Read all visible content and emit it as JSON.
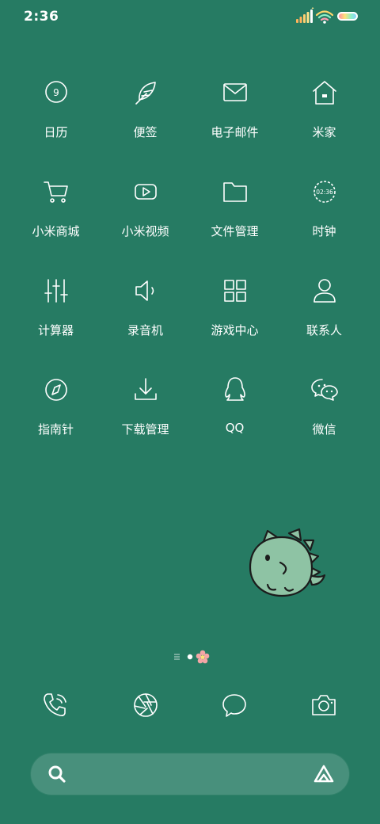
{
  "status_bar": {
    "time": "2:36",
    "battery_gradient": [
      "#ff8fa3",
      "#ffe27a",
      "#8ef0c7",
      "#8ad1ff"
    ]
  },
  "apps": [
    {
      "label": "日历",
      "icon": "calendar-icon",
      "badge": "9"
    },
    {
      "label": "便签",
      "icon": "feather-icon"
    },
    {
      "label": "电子邮件",
      "icon": "mail-icon"
    },
    {
      "label": "米家",
      "icon": "home-icon"
    },
    {
      "label": "小米商城",
      "icon": "cart-icon"
    },
    {
      "label": "小米视频",
      "icon": "play-icon"
    },
    {
      "label": "文件管理",
      "icon": "folder-icon"
    },
    {
      "label": "时钟",
      "icon": "clock-icon",
      "badge": "02:36"
    },
    {
      "label": "计算器",
      "icon": "sliders-icon"
    },
    {
      "label": "录音机",
      "icon": "speaker-icon"
    },
    {
      "label": "游戏中心",
      "icon": "grid-icon"
    },
    {
      "label": "联系人",
      "icon": "person-icon"
    },
    {
      "label": "指南针",
      "icon": "compass-icon"
    },
    {
      "label": "下载管理",
      "icon": "download-icon"
    },
    {
      "label": "QQ",
      "icon": "penguin-icon"
    },
    {
      "label": "微信",
      "icon": "wechat-icon"
    }
  ],
  "page_indicator": {
    "current_page": 2,
    "page_count": 3
  },
  "dock": [
    {
      "icon": "phone-icon"
    },
    {
      "icon": "aperture-icon"
    },
    {
      "icon": "message-icon"
    },
    {
      "icon": "camera-icon"
    }
  ],
  "search_bar": {
    "icon": "search-icon",
    "voice_icon": "assistant-icon"
  },
  "colors": {
    "background": "#267b63",
    "mascot": "#8ec3a4"
  }
}
